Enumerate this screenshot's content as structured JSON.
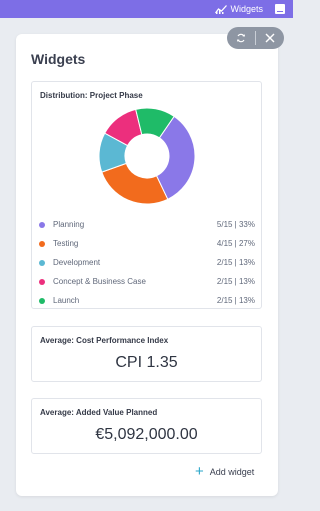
{
  "topbar": {
    "label": "Widgets",
    "icon": "chart-icon",
    "color": "#7d6ee6"
  },
  "panel": {
    "title": "Widgets",
    "controls": {
      "refresh_icon": "refresh-icon",
      "close_icon": "close-icon"
    }
  },
  "distribution": {
    "title": "Distribution: Project Phase",
    "items": [
      {
        "name": "Planning",
        "value": "5/15 | 33%",
        "count": 5,
        "color": "#8a78e8"
      },
      {
        "name": "Testing",
        "value": "4/15 | 27%",
        "count": 4,
        "color": "#f26b1d"
      },
      {
        "name": "Development",
        "value": "2/15 | 13%",
        "count": 2,
        "color": "#5bb8d3"
      },
      {
        "name": "Concept & Business Case",
        "value": "2/15 | 13%",
        "count": 2,
        "color": "#ec2f7d"
      },
      {
        "name": "Launch",
        "value": "2/15 | 13%",
        "count": 2,
        "color": "#1fbb68"
      }
    ]
  },
  "cpi": {
    "title": "Average: Cost Performance Index",
    "value": "CPI 1.35"
  },
  "added_value": {
    "title": "Average: Added Value Planned",
    "value": "€5,092,000.00"
  },
  "add_widget": {
    "label": "Add widget",
    "icon": "plus-icon",
    "color": "#2aa6c9"
  }
}
